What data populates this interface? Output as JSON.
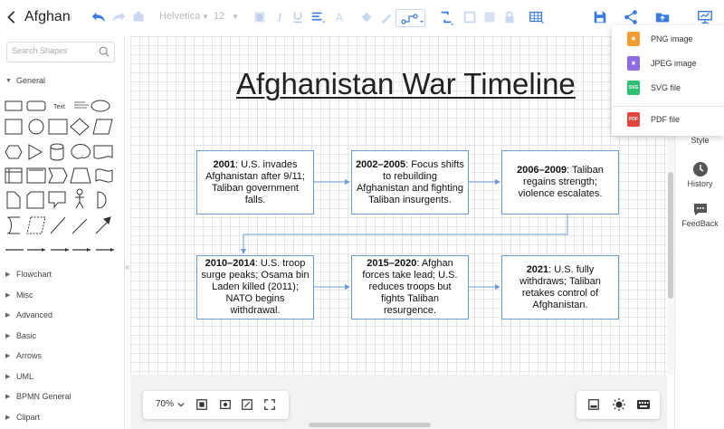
{
  "app": {
    "doc_title": "Afghanis"
  },
  "toolbar": {
    "font_family": "Helvetica",
    "font_size": "12",
    "accent_color": "#3a7be0"
  },
  "sidebar": {
    "search_placeholder": "Search Shapes",
    "general_label": "General",
    "text_shape_label": "Text",
    "sections": [
      "Flowchart",
      "Misc",
      "Advanced",
      "Basic",
      "Arrows",
      "UML",
      "BPMN General",
      "Clipart"
    ]
  },
  "diagram": {
    "title": "Afghanistan War Timeline",
    "events": [
      {
        "year": "2001",
        "text": ": U.S. invades Afghanistan after 9/11; Taliban government falls."
      },
      {
        "year": "2002–2005",
        "text": ": Focus shifts to rebuilding Afghanistan and fighting Taliban insurgents."
      },
      {
        "year": "2006–2009",
        "text": ": Taliban regains strength; violence escalates."
      },
      {
        "year": "2010–2014",
        "text": ": U.S. troop surge peaks; Osama bin Laden killed (2011); NATO begins withdrawal."
      },
      {
        "year": "2015–2020",
        "text": ": Afghan forces take lead; U.S. reduces troops but fights Taliban resurgence."
      },
      {
        "year": "2021",
        "text": ": U.S. fully withdraws; Taliban retakes control of Afghanistan."
      }
    ]
  },
  "zoom": {
    "level": "70%"
  },
  "right_panel": {
    "style_label": "Style",
    "history_label": "History",
    "feedback_label": "FeedBack"
  },
  "export_menu": {
    "items": [
      {
        "label": "PNG image",
        "icon": "png-file-icon",
        "color": "#f39c33"
      },
      {
        "label": "JPEG image",
        "icon": "jpeg-file-icon",
        "color": "#8e6be0"
      },
      {
        "label": "SVG file",
        "icon": "svg-file-icon",
        "color": "#2fbf71"
      },
      {
        "label": "PDF file",
        "icon": "pdf-file-icon",
        "color": "#e0463a"
      }
    ]
  }
}
